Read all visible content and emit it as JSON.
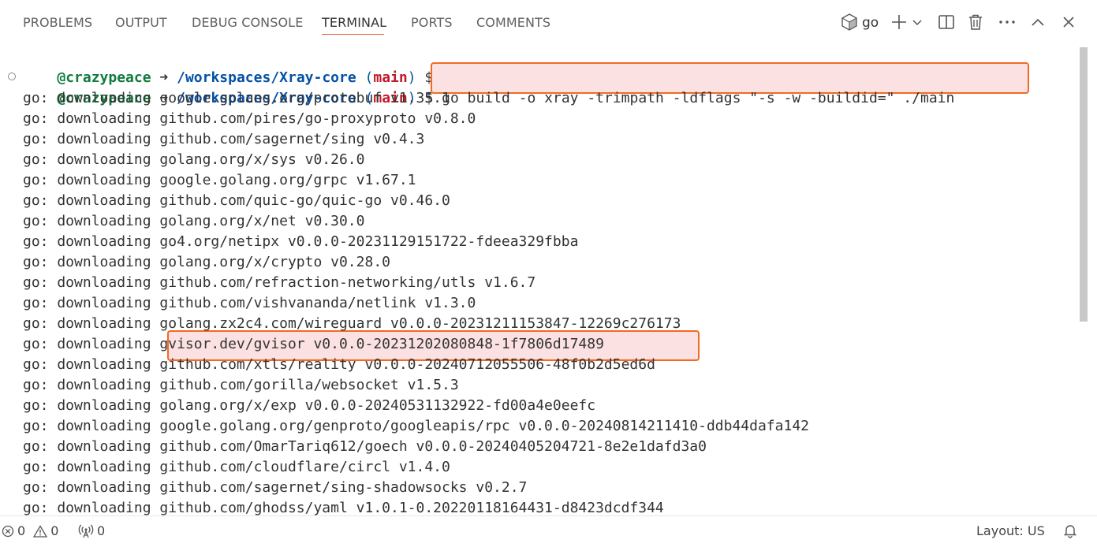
{
  "panel": {
    "tabs": [
      {
        "label": "PROBLEMS"
      },
      {
        "label": "OUTPUT"
      },
      {
        "label": "DEBUG CONSOLE"
      },
      {
        "label": "TERMINAL"
      },
      {
        "label": "PORTS"
      },
      {
        "label": "COMMENTS"
      }
    ],
    "active_tab": "TERMINAL",
    "terminal_name": "go",
    "toolbar_icons": [
      "terminal-shell-icon",
      "new-terminal-icon",
      "launch-profile-chevron-icon",
      "split-terminal-icon",
      "kill-terminal-icon",
      "more-actions-icon",
      "maximize-panel-icon",
      "close-panel-icon"
    ]
  },
  "terminal": {
    "prompt1": {
      "user": "@crazypeace",
      "arrow": "➜",
      "cwd": "/workspaces/Xray-core",
      "branch": "main",
      "symbol": "$",
      "command": ""
    },
    "prompt2": {
      "user": "@crazypeace",
      "arrow": "➜",
      "cwd": "/workspaces/Xray-core",
      "branch": "main",
      "symbol": "$",
      "command": "go build -o xray -trimpath -ldflags \"-s -w -buildid=\" ./main"
    },
    "output_lines": [
      "go: downloading google.golang.org/protobuf v1.35.1",
      "go: downloading github.com/pires/go-proxyproto v0.8.0",
      "go: downloading github.com/sagernet/sing v0.4.3",
      "go: downloading golang.org/x/sys v0.26.0",
      "go: downloading google.golang.org/grpc v1.67.1",
      "go: downloading github.com/quic-go/quic-go v0.46.0",
      "go: downloading golang.org/x/net v0.30.0",
      "go: downloading go4.org/netipx v0.0.0-20231129151722-fdeea329fbba",
      "go: downloading golang.org/x/crypto v0.28.0",
      "go: downloading github.com/refraction-networking/utls v1.6.7",
      "go: downloading github.com/vishvananda/netlink v1.3.0",
      "go: downloading golang.zx2c4.com/wireguard v0.0.0-20231211153847-12269c276173",
      "go: downloading gvisor.dev/gvisor v0.0.0-20231202080848-1f7806d17489",
      "go: downloading github.com/xtls/reality v0.0.0-20240712055506-48f0b2d5ed6d",
      "go: downloading github.com/gorilla/websocket v1.5.3",
      "go: downloading golang.org/x/exp v0.0.0-20240531132922-fd00a4e0eefc",
      "go: downloading google.golang.org/genproto/googleapis/rpc v0.0.0-20240814211410-ddb44dafa142",
      "go: downloading github.com/OmarTariq612/goech v0.0.0-20240405204721-8e2e1dafd3a0",
      "go: downloading github.com/cloudflare/circl v1.4.0",
      "go: downloading github.com/sagernet/sing-shadowsocks v0.2.7",
      "go: downloading github.com/ghodss/yaml v1.0.1-0.20220118164431-d8423dcdf344"
    ]
  },
  "statusbar": {
    "errors": "0",
    "warnings": "0",
    "ports": "0",
    "layout": "Layout: US"
  },
  "colors": {
    "accent_underline": "#e45b2a",
    "highlight_border": "#f26a21",
    "user": "#0f7b3d",
    "cwd": "#0451a5",
    "branch": "#c01b2b"
  }
}
